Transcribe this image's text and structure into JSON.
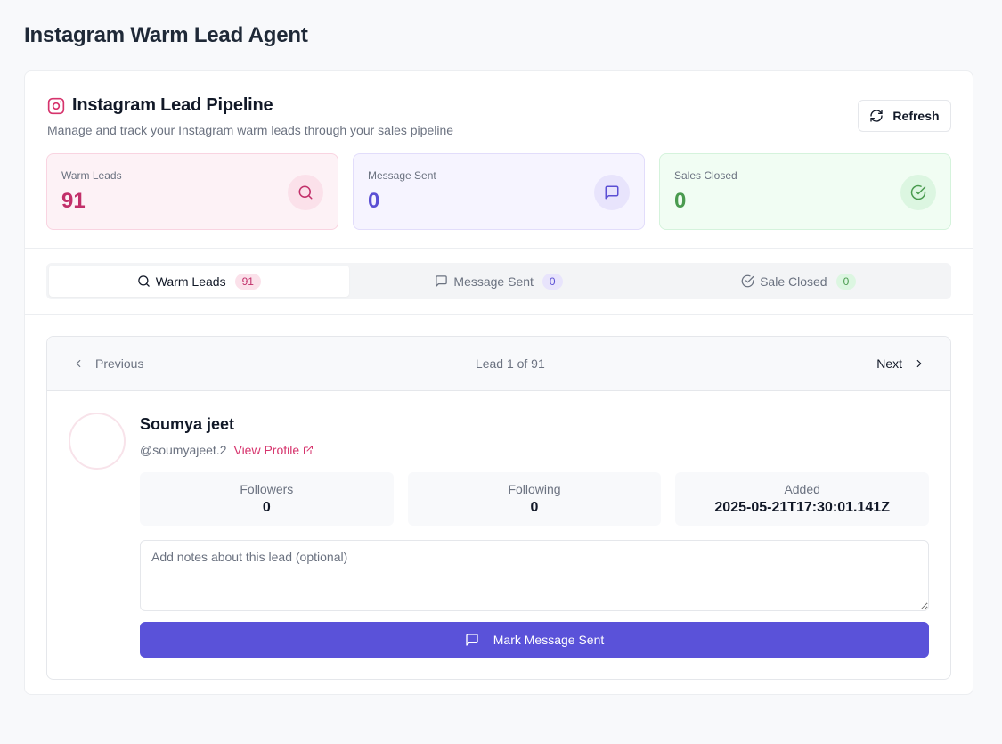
{
  "app": {
    "title": "Instagram Warm Lead Agent"
  },
  "pipeline": {
    "title": "Instagram Lead Pipeline",
    "description": "Manage and track your Instagram warm leads through your sales pipeline",
    "refresh_label": "Refresh"
  },
  "stats": [
    {
      "label": "Warm Leads",
      "value": "91",
      "icon": "search-icon",
      "color": "#c2306a"
    },
    {
      "label": "Message Sent",
      "value": "0",
      "icon": "message-icon",
      "color": "#5b4fd4"
    },
    {
      "label": "Sales Closed",
      "value": "0",
      "icon": "check-circle-icon",
      "color": "#4a9b4f"
    }
  ],
  "tabs": [
    {
      "label": "Warm Leads",
      "count": "91",
      "icon": "search-icon",
      "active": true
    },
    {
      "label": "Message Sent",
      "count": "0",
      "icon": "message-icon",
      "active": false
    },
    {
      "label": "Sale Closed",
      "count": "0",
      "icon": "check-circle-icon",
      "active": false
    }
  ],
  "navigation": {
    "previous_label": "Previous",
    "counter": "Lead 1 of 91",
    "next_label": "Next"
  },
  "lead": {
    "name": "Soumya jeet",
    "handle": "@soumyajeet.2",
    "view_profile_label": "View Profile",
    "metrics": [
      {
        "label": "Followers",
        "value": "0"
      },
      {
        "label": "Following",
        "value": "0"
      },
      {
        "label": "Added",
        "value": "2025-05-21T17:30:01.141Z"
      }
    ],
    "notes_placeholder": "Add notes about this lead (optional)",
    "notes_value": "",
    "mark_button_label": "Mark Message Sent"
  },
  "colors": {
    "accent": "#5a52d9",
    "brand_pink": "#d6336c"
  }
}
